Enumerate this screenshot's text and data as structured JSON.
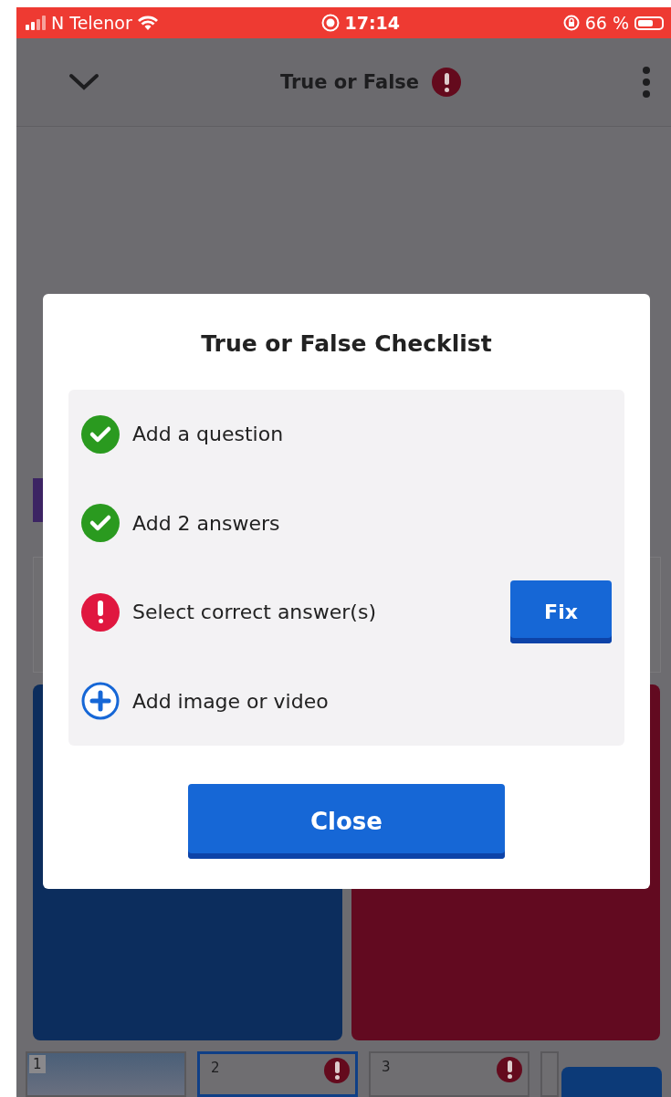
{
  "status_bar": {
    "carrier": "N Telenor",
    "time": "17:14",
    "battery": "66 %"
  },
  "header": {
    "title": "True or False",
    "has_error": true
  },
  "slides": [
    {
      "number": "1",
      "kind": "photo",
      "selected": false,
      "has_error": false
    },
    {
      "number": "2",
      "kind": "blank",
      "selected": true,
      "has_error": true
    },
    {
      "number": "3",
      "kind": "blank",
      "selected": false,
      "has_error": true
    },
    {
      "kind": "blank",
      "selected": false,
      "has_error": false
    }
  ],
  "dialog": {
    "title": "True or False Checklist",
    "items": [
      {
        "label": "Add a question",
        "kind": "done"
      },
      {
        "label": "Add 2 answers",
        "kind": "done"
      },
      {
        "label": "Select correct answer(s)",
        "kind": "error",
        "action": "Fix"
      },
      {
        "label": "Add image or video",
        "kind": "add"
      }
    ],
    "close_button": "Close"
  }
}
